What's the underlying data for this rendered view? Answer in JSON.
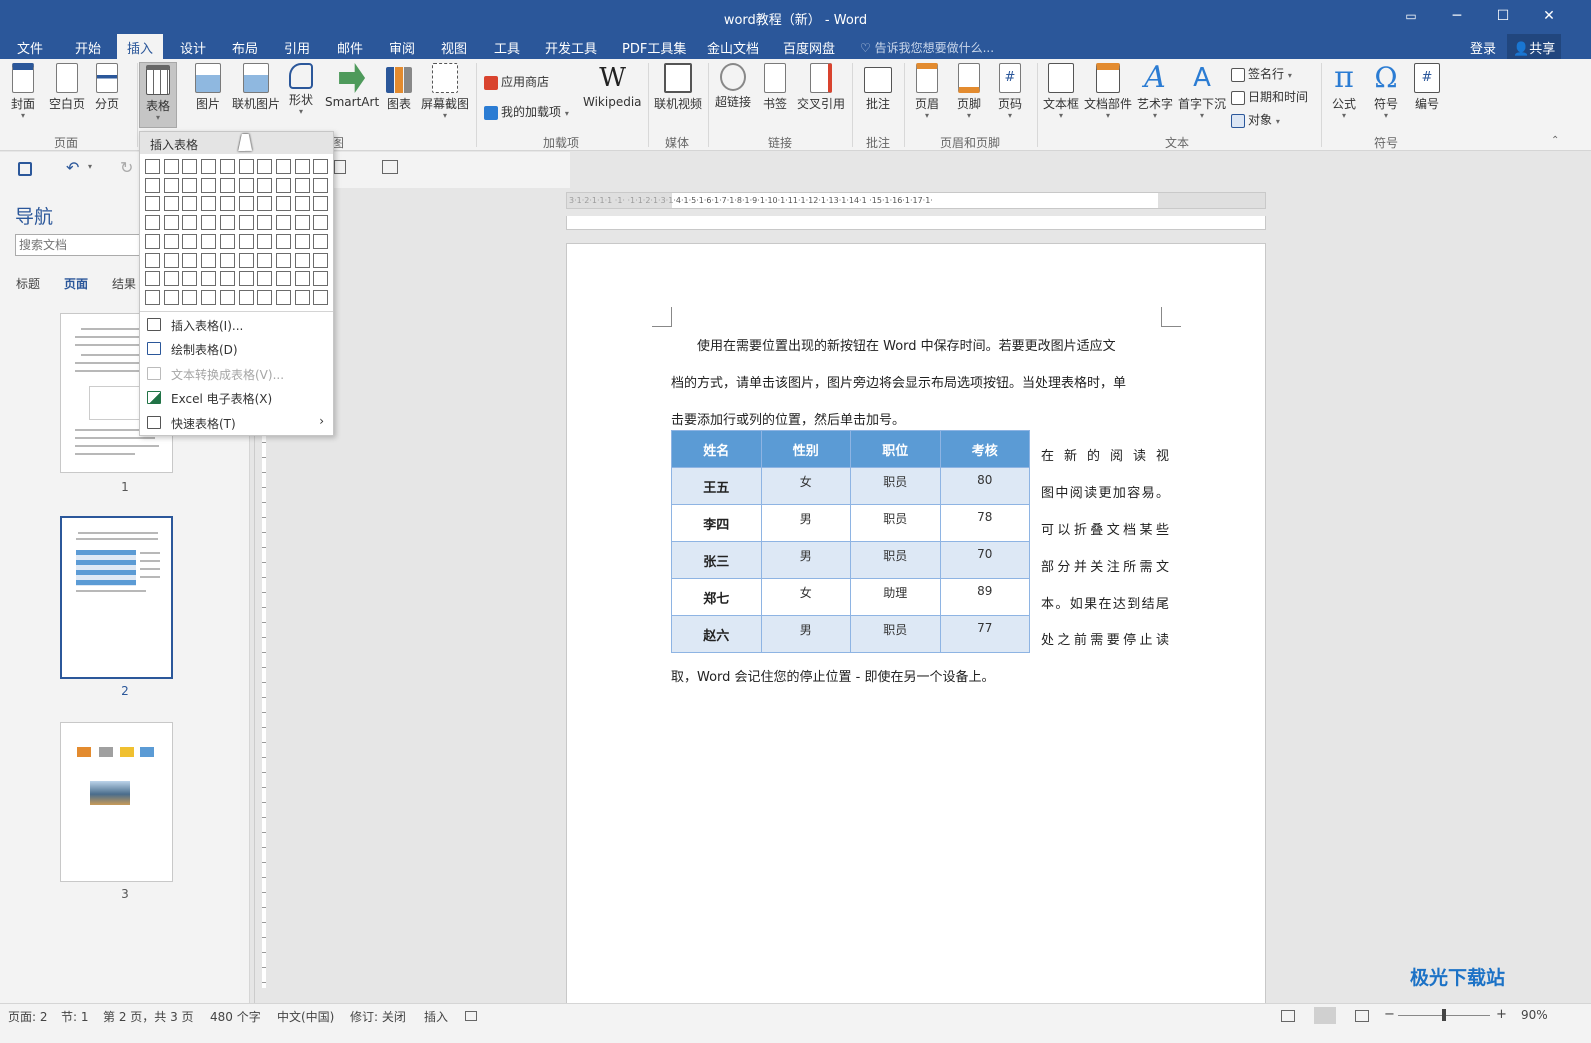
{
  "titlebar": {
    "title": "word教程（新） - Word",
    "ribbon_options_icon": "ribbon-display-icon",
    "min": "─",
    "max": "☐",
    "close": "✕"
  },
  "tabs": [
    "文件",
    "开始",
    "插入",
    "设计",
    "布局",
    "引用",
    "邮件",
    "审阅",
    "视图",
    "工具",
    "开发工具",
    "PDF工具集",
    "金山文档",
    "百度网盘"
  ],
  "tell_me": "告诉我您想要做什么...",
  "login": "登录",
  "share": "共享",
  "ribbon": {
    "pages": {
      "cover": "封面",
      "blank": "空白页",
      "break": "分页",
      "group": "页面"
    },
    "table": {
      "label": "表格"
    },
    "illus": {
      "picture": "图片",
      "online_picture": "联机图片",
      "shapes": "形状",
      "smartart": "SmartArt",
      "chart": "图表",
      "screenshot": "屏幕截图",
      "group_tail": "图"
    },
    "addins": {
      "store": "应用商店",
      "my_addins": "我的加载项",
      "wikipedia": "Wikipedia",
      "wiki_glyph": "W",
      "group": "加载项"
    },
    "media": {
      "online_video": "联机视频",
      "group": "媒体"
    },
    "links": {
      "hyperlink": "超链接",
      "bookmark": "书签",
      "crossref": "交叉引用",
      "group": "链接"
    },
    "comments": {
      "comment": "批注",
      "group": "批注"
    },
    "hf": {
      "header": "页眉",
      "footer": "页脚",
      "page_number": "页码",
      "group": "页眉和页脚"
    },
    "text": {
      "textbox": "文本框",
      "quickparts": "文档部件",
      "wordart": "艺术字",
      "dropcap": "首字下沉",
      "signature": "签名行",
      "datetime": "日期和时间",
      "object": "对象",
      "group": "文本"
    },
    "symbols": {
      "equation": "公式",
      "symbol": "符号",
      "number": "编号",
      "eq_glyph": "π",
      "sym_glyph": "Ω",
      "group": "符号"
    }
  },
  "dropdown": {
    "title": "插入表格",
    "items": [
      {
        "label": "插入表格(I)...",
        "icon": "table-icon",
        "disabled": false
      },
      {
        "label": "绘制表格(D)",
        "icon": "draw-table-icon",
        "disabled": false
      },
      {
        "label": "文本转换成表格(V)...",
        "icon": "convert-text-icon",
        "disabled": true
      },
      {
        "label": "Excel 电子表格(X)",
        "icon": "excel-icon",
        "disabled": false
      },
      {
        "label": "快速表格(T)",
        "icon": "quick-table-icon",
        "disabled": false
      }
    ],
    "submenu_arrow": "›"
  },
  "nav": {
    "title": "导航",
    "search_placeholder": "搜索文档",
    "tabs": [
      "标题",
      "页面",
      "结果"
    ],
    "pages": [
      "1",
      "2",
      "3"
    ]
  },
  "ruler": {
    "h": "3·1·2·1·1·1 ·1· ·1·1·2·1·3·1·4·1·5·1·6·1·7·1·8·1·9·1·10·1·11·1·12·1·13·1·14·1 ·15·1·16·1·17·1·"
  },
  "document": {
    "para1": [
      "使用在需要位置出现的新按钮在 Word 中保存时间。若要更改图片适应文",
      "档的方式，请单击该图片，图片旁边将会显示布局选项按钮。当处理表格时，单",
      "击要添加行或列的位置，然后单击加号。"
    ],
    "side": [
      "在新的阅读视",
      "图中阅读更加容易。",
      "可以折叠文档某些",
      "部分并关注所需文",
      "本。如果在达到结尾",
      "处之前需要停止读"
    ],
    "tail": "取，Word 会记住您的停止位置 - 即使在另一个设备上。",
    "table_headers": [
      "姓名",
      "性别",
      "职位",
      "考核"
    ],
    "table_rows": [
      [
        "王五",
        "女",
        "职员",
        "80"
      ],
      [
        "李四",
        "男",
        "职员",
        "78"
      ],
      [
        "张三",
        "男",
        "职员",
        "70"
      ],
      [
        "郑七",
        "女",
        "助理",
        "89"
      ],
      [
        "赵六",
        "男",
        "职员",
        "77"
      ]
    ]
  },
  "status": {
    "page": "页面: 2",
    "section": "节: 1",
    "pages": "第 2 页，共 3 页",
    "words": "480 个字",
    "lang": "中文(中国)",
    "track": "修订: 关闭",
    "mode": "插入",
    "zoom": "90%"
  },
  "watermark": "极光下载站",
  "colors": {
    "accent": "#2b579a",
    "table_header": "#5b9bd5",
    "table_odd": "#dde8f5"
  }
}
